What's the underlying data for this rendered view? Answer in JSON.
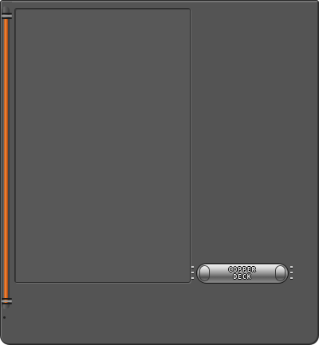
{
  "branding": {
    "logo_line1": "COPPER",
    "logo_line2": "DECK"
  },
  "colors": {
    "body": "#545454",
    "panel": "#585858",
    "pipe_accent": "#e56d22"
  }
}
